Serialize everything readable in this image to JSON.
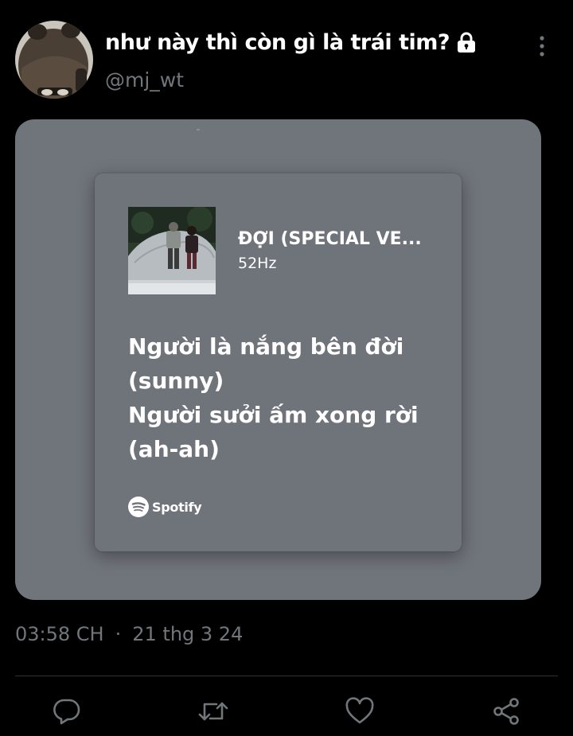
{
  "tweet": {
    "display_name": "như này thì còn gì là trái tim?",
    "handle": "@mj_wt",
    "timestamp": "03:58 CH",
    "separator": "·",
    "date": "21 thg 3 24"
  },
  "spotify_card": {
    "song_title": "ĐỢI (SPECIAL VE...",
    "artist": "52Hz",
    "lyrics": [
      "Người là nắng bên đời",
      "(sunny)",
      "Người sưởi ấm xong rời",
      "(ah-ah)"
    ],
    "brand_label": "Spotify"
  },
  "icons": {
    "lock": "lock-icon",
    "more": "more-vertical-icon",
    "reply": "reply-icon",
    "retweet": "retweet-icon",
    "like": "heart-icon",
    "share": "share-icon",
    "spotify": "spotify-icon"
  },
  "colors": {
    "background": "#000000",
    "secondary_text": "#71767b",
    "card_background": "#70747b",
    "divider": "#2f3336"
  }
}
